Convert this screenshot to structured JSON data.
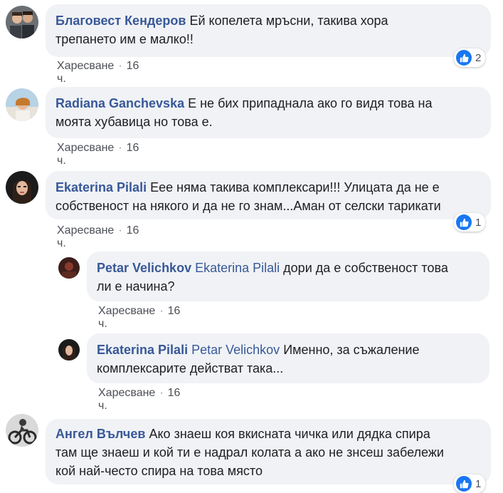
{
  "comments": [
    {
      "author": "Благовест Кендеров",
      "text": "Ей копелета мръсни, такива хора",
      "text_line2": "трепането им е малко!!",
      "like_label": "Харесване",
      "time": "16 ч.",
      "reaction_count": "2"
    },
    {
      "author": "Radiana Ganchevska",
      "text": "Е не бих припаднала ако го видя това на",
      "text_line2": "моята хубавица но това е.",
      "like_label": "Харесване",
      "time": "16 ч."
    },
    {
      "author": "Ekaterina Pilali",
      "text": "Еее няма такива комплексари!!! Улицата да не е",
      "text_line2": "собственост на някого и да не го знам...Аман от селски тарикати",
      "like_label": "Харесване",
      "time": "16 ч.",
      "reaction_count": "1"
    },
    {
      "author": "Petar Velichkov",
      "mention": "Ekaterina Pilali",
      "text": "дори да е собственост това",
      "text_line2": "ли е начина?",
      "like_label": "Харесване",
      "time": "16 ч."
    },
    {
      "author": "Ekaterina Pilali",
      "mention": "Petar Velichkov",
      "text": "Именно, за съжаление",
      "text_line2": "комплексарите действат така...",
      "like_label": "Харесване",
      "time": "16 ч."
    },
    {
      "author": "Ангел Вълчев",
      "text": "Ако знаеш коя вкисната чичка или дядка спира",
      "text_line2": "там ще знаеш и кой ти е надрал колата а ако не знсеш забележи",
      "text_line3": "кой най-често спира на това място",
      "reaction_count": "1"
    }
  ],
  "colors": {
    "bubble": "#f0f2f5",
    "author": "#385898",
    "like_blue": "#1877f2",
    "meta": "#4b4f56"
  },
  "icons": {
    "like": "thumbs-up-icon",
    "avatar": "user-avatar"
  }
}
